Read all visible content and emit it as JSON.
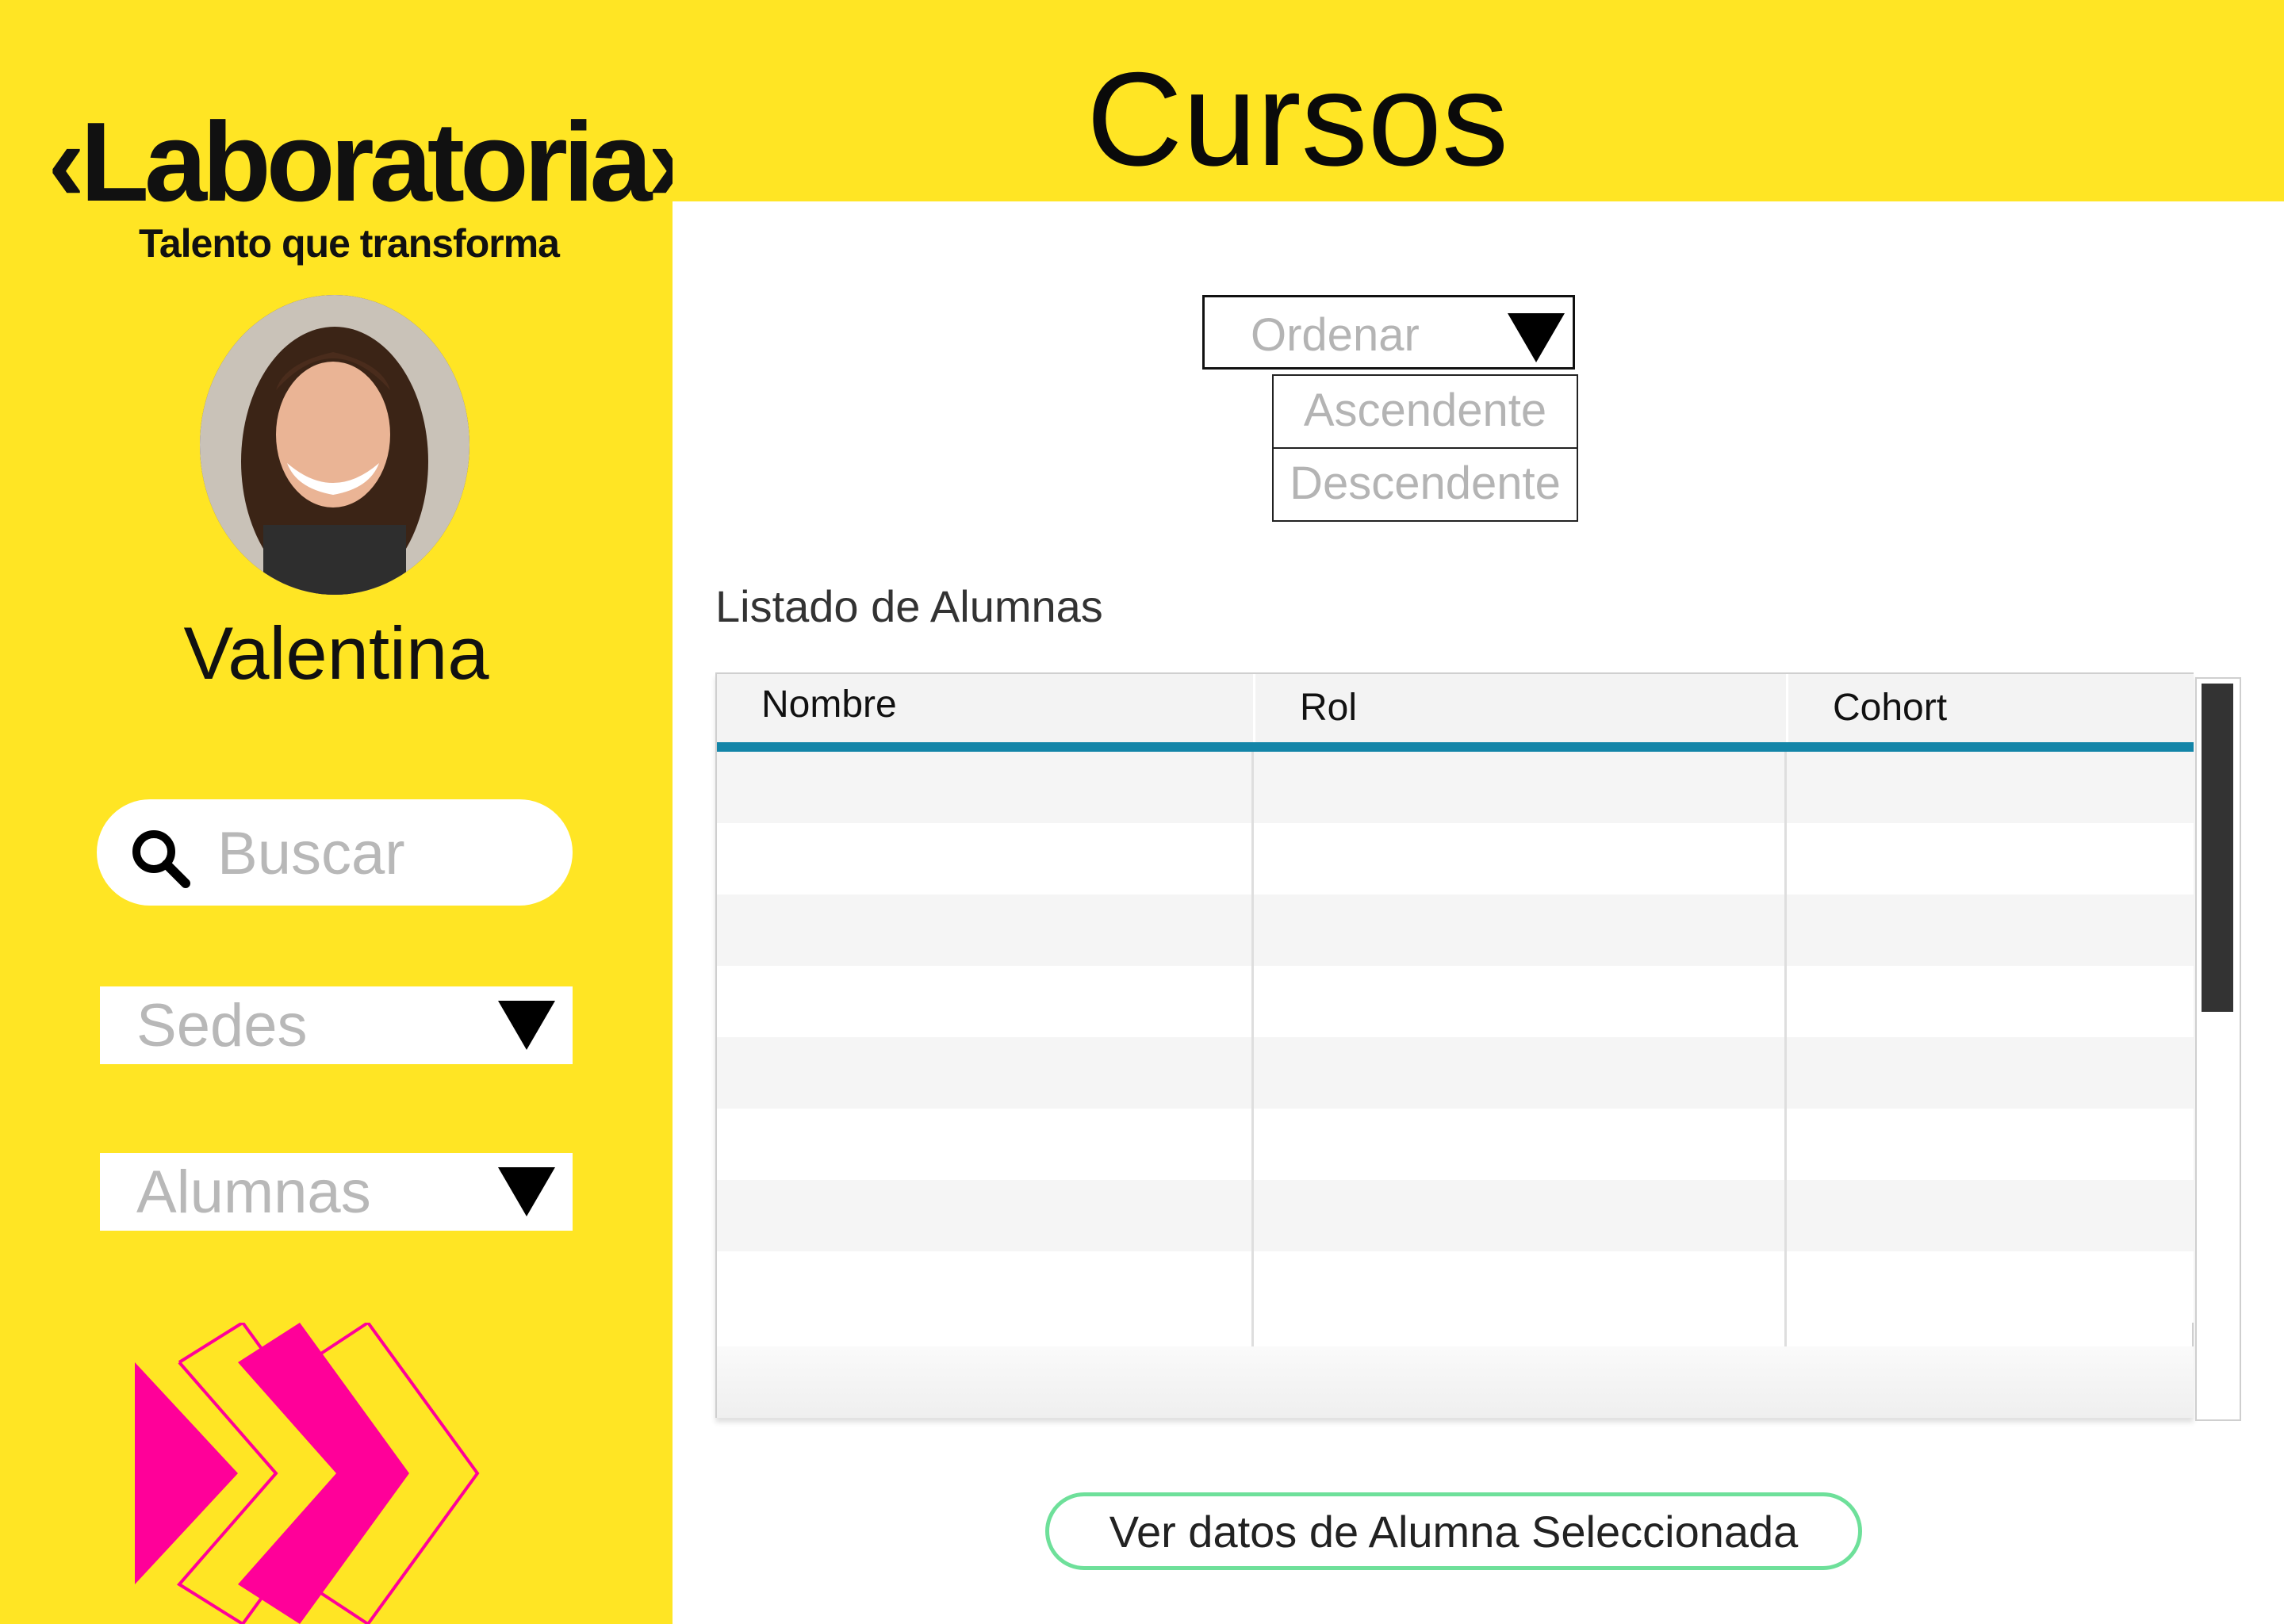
{
  "brand": {
    "name": "Laboratoria",
    "tagline": "Talento que transforma"
  },
  "user": {
    "name": "Valentina"
  },
  "search": {
    "placeholder": "Buscar",
    "icon": "search-icon"
  },
  "filters": {
    "sedes_label": "Sedes",
    "alumnas_label": "Alumnas"
  },
  "page": {
    "title": "Cursos"
  },
  "sort": {
    "label": "Ordenar",
    "options": [
      "Ascendente",
      "Descendente"
    ]
  },
  "list": {
    "title": "Listado de Alumnas",
    "columns": [
      "Nombre",
      "Rol",
      "Cohort"
    ],
    "rows": []
  },
  "actions": {
    "view_selected": "Ver datos de Alumna Seleccionada"
  },
  "colors": {
    "brand_yellow": "#ffe524",
    "accent_magenta": "#ff0099",
    "table_header_rule": "#1385a8",
    "button_border": "#6ee09a"
  }
}
